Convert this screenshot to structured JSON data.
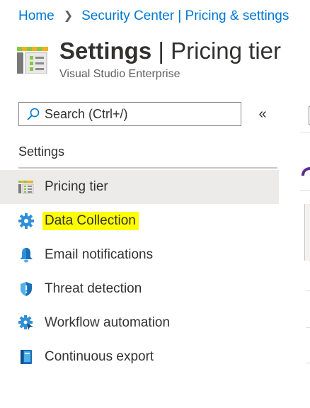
{
  "breadcrumb": {
    "home": "Home",
    "parent": "Security Center | Pricing & settings"
  },
  "header": {
    "title_main": "Settings",
    "title_separator": "|",
    "title_sub": "Pricing tier",
    "subtitle": "Visual Studio Enterprise",
    "icon": "settings-list-icon"
  },
  "search": {
    "placeholder": "Search (Ctrl+/)",
    "icon": "search-icon"
  },
  "collapse": {
    "glyph": "«",
    "icon": "double-chevron-left-icon"
  },
  "section": {
    "title": "Settings"
  },
  "menu": {
    "items": [
      {
        "label": "Pricing tier",
        "icon": "pricing-tier-icon",
        "selected": true
      },
      {
        "label": "Data Collection",
        "icon": "gear-icon",
        "highlighted": true
      },
      {
        "label": "Email notifications",
        "icon": "bell-icon"
      },
      {
        "label": "Threat detection",
        "icon": "shield-icon"
      },
      {
        "label": "Workflow automation",
        "icon": "workflow-gear-icon"
      },
      {
        "label": "Continuous export",
        "icon": "book-icon"
      }
    ]
  },
  "colors": {
    "link": "#0078d4",
    "text": "#323130",
    "selected_bg": "#edebe9",
    "highlight": "#ffff00",
    "icon_blue": "#0078d4",
    "icon_blue_light": "#50b0e8"
  }
}
